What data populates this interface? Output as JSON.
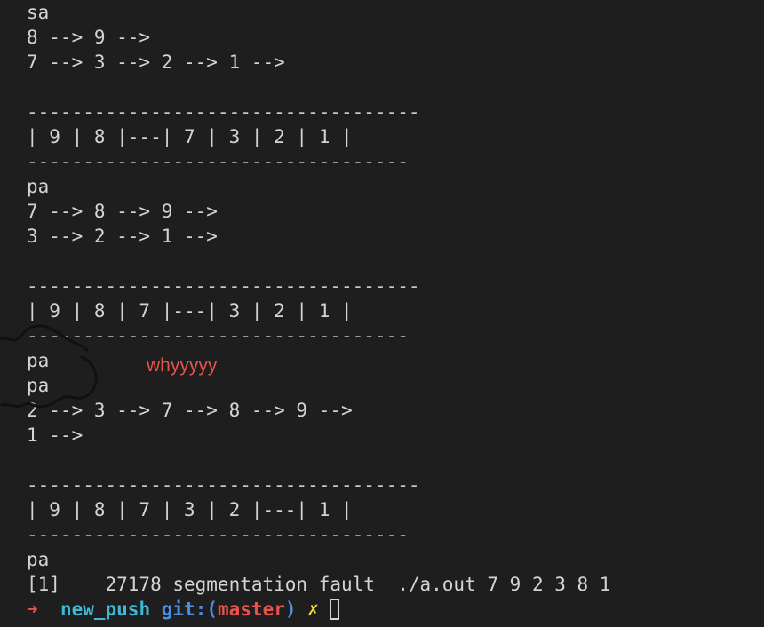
{
  "terminal": {
    "lines": [
      {
        "text": "sa"
      },
      {
        "text": "8 --> 9 -->"
      },
      {
        "text": "7 --> 3 --> 2 --> 1 -->"
      },
      {
        "text": ""
      },
      {
        "text": "-----------------------------------"
      },
      {
        "text": "| 9 | 8 |---| 7 | 3 | 2 | 1 |"
      },
      {
        "text": "----------------------------------"
      },
      {
        "text": "pa"
      },
      {
        "text": "7 --> 8 --> 9 -->"
      },
      {
        "text": "3 --> 2 --> 1 -->"
      },
      {
        "text": ""
      },
      {
        "text": "-----------------------------------"
      },
      {
        "text": "| 9 | 8 | 7 |---| 3 | 2 | 1 |"
      },
      {
        "text": "----------------------------------"
      },
      {
        "text": "pa"
      },
      {
        "text": "pa"
      },
      {
        "text": "2 --> 3 --> 7 --> 8 --> 9 -->"
      },
      {
        "text": "1 -->"
      },
      {
        "text": ""
      },
      {
        "text": "-----------------------------------"
      },
      {
        "text": "| 9 | 8 | 7 | 3 | 2 |---| 1 |"
      },
      {
        "text": "----------------------------------"
      },
      {
        "text": "pa"
      },
      {
        "text": "[1]    27178 segmentation fault  ./a.out 7 9 2 3 8 1"
      }
    ],
    "prompt": {
      "arrow": "➜",
      "directory": "new_push",
      "git_label": "git:",
      "paren_open": "(",
      "branch": "master",
      "paren_close": ")",
      "dirty_marker": "✗"
    }
  },
  "annotation": {
    "text": "whyyyyy",
    "color": "#e5534b"
  },
  "colors": {
    "background": "#1e1e1e",
    "foreground": "#d4d4d4",
    "prompt_arrow": "#e5534b",
    "directory": "#3fb8d6",
    "git": "#4a8fe0",
    "dirty": "#f2d33d"
  }
}
